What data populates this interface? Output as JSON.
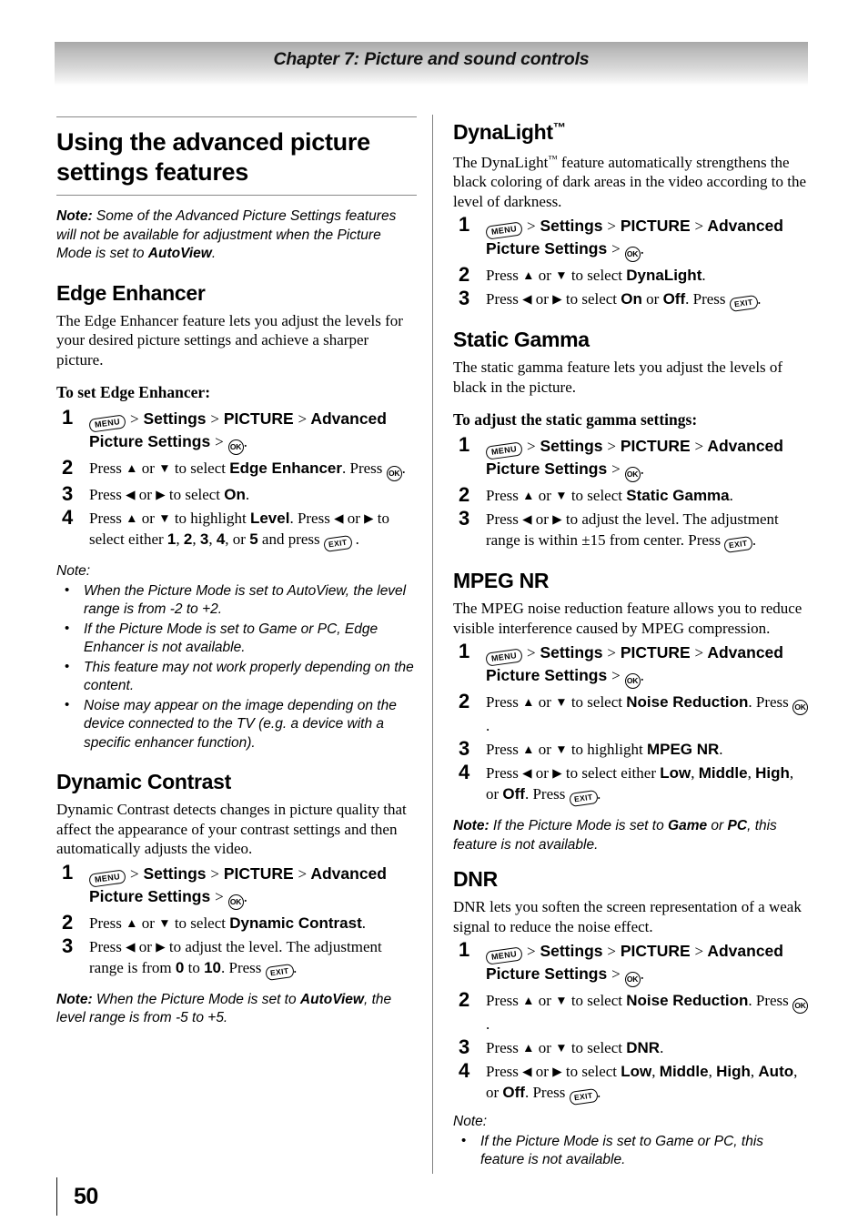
{
  "header": {
    "chapter": "Chapter 7: Picture and sound controls"
  },
  "footer": {
    "page_number": "50"
  },
  "icons": {
    "menu": "MENU",
    "ok": "OK",
    "exit": "EXIT"
  },
  "left_column": {
    "title": "Using the advanced picture settings features",
    "intro_note": {
      "label": "Note:",
      "text_1": " Some of the Advanced Picture Settings features will not be available for adjustment when the Picture Mode is set to ",
      "bold_1": "AutoView",
      "text_2": "."
    },
    "edge_enhancer": {
      "heading": "Edge Enhancer",
      "body": "The Edge Enhancer feature lets you adjust the levels for your desired picture settings and achieve a sharper picture.",
      "subhead": "To set Edge Enhancer:",
      "step1": {
        "sep1": ">",
        "settings": "Settings",
        "sep2": ">",
        "picture": "PICTURE",
        "sep3": ">",
        "advanced": "Advanced Picture Settings",
        "sep4": ">",
        "period": "."
      },
      "step2": {
        "press": "Press ",
        "or": " or ",
        "to_select": " to select ",
        "target": "Edge Enhancer",
        "tail": ". Press ",
        "period": "."
      },
      "step3": {
        "press": "Press ",
        "or": " or ",
        "to_select": " to select ",
        "target": "On",
        "period": "."
      },
      "step4": {
        "press": "Press ",
        "or": " or ",
        "to_highlight": " to highlight ",
        "target": "Level",
        "mid": ". Press ",
        "or2": " or ",
        "to_select": " to select either ",
        "v1": "1",
        "c1": ", ",
        "v2": "2",
        "c2": ", ",
        "v3": "3",
        "c3": ", ",
        "v4": "4",
        "c4": ", or ",
        "v5": "5",
        "and_press": " and press ",
        "period": " ."
      },
      "note_label": "Note:",
      "notes": [
        {
          "a": "When the Picture Mode is set to ",
          "b": "AutoView",
          "c": ", the level range is from -2 to +2."
        },
        {
          "a": "If the Picture Mode is set to ",
          "b": "Game",
          "c": " or ",
          "d": "PC",
          "e": ", Edge Enhancer is not available."
        },
        {
          "a": "This feature may not work properly depending on the content."
        },
        {
          "a": "Noise may appear on the image depending on the device connected to the TV (e.g. a device with a specific enhancer function)."
        }
      ]
    },
    "dynamic_contrast": {
      "heading": "Dynamic Contrast",
      "body": "Dynamic Contrast detects changes in picture quality that affect the appearance of your contrast settings and then automatically adjusts the video.",
      "step2": {
        "press": "Press ",
        "or": " or ",
        "to_select": " to select ",
        "target": "Dynamic Contrast",
        "period": "."
      },
      "step3": {
        "press": "Press ",
        "or": " or ",
        "to_adjust": " to adjust the level. The adjustment range is from ",
        "min": "0",
        "to": " to ",
        "max": "10",
        "press2": ". Press ",
        "period": "."
      },
      "note": {
        "label": "Note:",
        "a": " When the Picture Mode is set to ",
        "b": "AutoView",
        "c": ", the level range is from -5 to +5."
      }
    }
  },
  "right_column": {
    "dynalight": {
      "heading": "DynaLight",
      "heading_tm": "™",
      "body_a": "The DynaLight",
      "body_tm": "™",
      "body_b": " feature automatically strengthens the black coloring of dark areas in the video according to the level of darkness.",
      "step2": {
        "press": "Press ",
        "or": " or ",
        "to_select": " to select ",
        "target": "DynaLight",
        "period": "."
      },
      "step3": {
        "press": "Press ",
        "or": " or ",
        "to_select": " to select ",
        "on": "On",
        "or2": " or ",
        "off": "Off",
        "press2": ". Press ",
        "period": "."
      }
    },
    "static_gamma": {
      "heading": "Static Gamma",
      "body": "The static gamma feature lets you adjust the levels of black in the picture.",
      "subhead": "To adjust the static gamma settings:",
      "step2": {
        "press": "Press ",
        "or": " or ",
        "to_select": " to select ",
        "target": "Static Gamma",
        "period": "."
      },
      "step3": {
        "press": "Press ",
        "or": " or ",
        "to_adjust": " to adjust the level. The adjustment range is within ±15 from center. Press ",
        "period": "."
      }
    },
    "mpeg_nr": {
      "heading": "MPEG NR",
      "body": "The MPEG noise reduction feature allows you to reduce visible interference caused by MPEG compression.",
      "step2": {
        "press": "Press ",
        "or": " or ",
        "to_select": " to select ",
        "target": "Noise Reduction",
        "tail": ". Press ",
        "period": "."
      },
      "step3": {
        "press": "Press ",
        "or": " or ",
        "to_highlight": " to highlight ",
        "target": "MPEG NR",
        "period": "."
      },
      "step4": {
        "press": "Press ",
        "or": " or ",
        "to_select": " to select either ",
        "o1": "Low",
        "c1": ", ",
        "o2": "Middle",
        "c2": ", ",
        "o3": "High",
        "c3": ", or ",
        "o4": "Off",
        "press2": ". Press ",
        "period": "."
      },
      "note": {
        "label": "Note:",
        "a": " If the Picture Mode is set to ",
        "b": "Game",
        "c": " or ",
        "d": "PC",
        "e": ", this feature is not available."
      }
    },
    "dnr": {
      "heading": "DNR",
      "body": "DNR lets you soften the screen representation of a weak signal to reduce the noise effect.",
      "step2": {
        "press": "Press ",
        "or": " or ",
        "to_select": " to select ",
        "target": "Noise Reduction",
        "tail": ". Press ",
        "period": "."
      },
      "step3": {
        "press": "Press ",
        "or": " or ",
        "to_select": " to select ",
        "target": "DNR",
        "period": "."
      },
      "step4": {
        "press": "Press ",
        "or": " or ",
        "to_select": " to select ",
        "o1": "Low",
        "c1": ", ",
        "o2": "Middle",
        "c2": ", ",
        "o3": "High",
        "c3": ", ",
        "o4": "Auto",
        "c4": ", or ",
        "o5": "Off",
        "press2": ". Press ",
        "period": "."
      },
      "note_label": "Note:",
      "notes": [
        {
          "a": "If the Picture Mode is set to ",
          "b": "Game",
          "c": " or ",
          "d": "PC",
          "e": ", this feature is not available."
        }
      ]
    }
  },
  "menu_path": {
    "sep": ">",
    "settings": "Settings",
    "picture": "PICTURE",
    "advanced": "Advanced Picture Settings",
    "period": "."
  },
  "arrows": {
    "up": "▲",
    "down": "▼",
    "left": "◀",
    "right": "▶"
  }
}
